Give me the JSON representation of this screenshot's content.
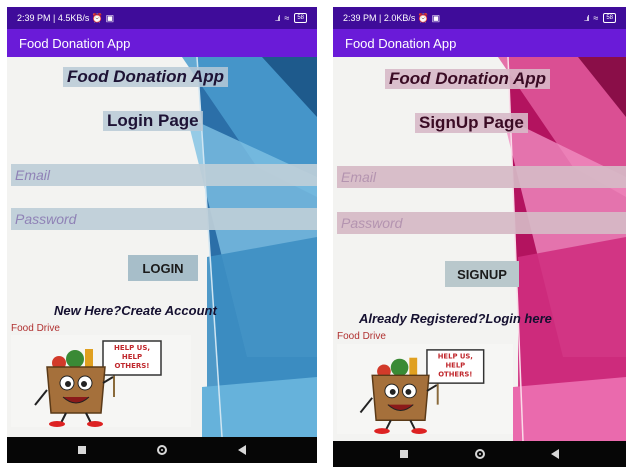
{
  "login": {
    "status": {
      "left": "2:39 PM | 4.5KB/s ⏰ ▣",
      "signal": "..ıl",
      "wifi": "≈",
      "battery": "58"
    },
    "appbar_title": "Food Donation App",
    "title": "Food Donation App",
    "page_title": "Login Page",
    "email_placeholder": "Email",
    "password_placeholder": "Password",
    "button_label": "LOGIN",
    "link_text": "New Here?Create Account",
    "banner_label": "Food Drive",
    "sign_text": [
      "HELP US,",
      "HELP",
      "OTHERS!"
    ]
  },
  "signup": {
    "status": {
      "left": "2:39 PM | 2.0KB/s ⏰ ▣",
      "signal": "..ıl",
      "wifi": "≈",
      "battery": "58"
    },
    "appbar_title": "Food Donation App",
    "title": "Food Donation App",
    "page_title": "SignUp Page",
    "email_placeholder": "Email",
    "password_placeholder": "Password",
    "button_label": "SIGNUP",
    "link_text": "Already Registered?Login here",
    "banner_label": "Food Drive",
    "sign_text": [
      "HELP US,",
      "HELP",
      "OTHERS!"
    ]
  },
  "theme": {
    "statusbar": "#3f0c9a",
    "appbar": "#6a1bd8",
    "login_accent": "#2a7fb8",
    "signup_accent": "#d4267f",
    "navbar": "#060606"
  }
}
